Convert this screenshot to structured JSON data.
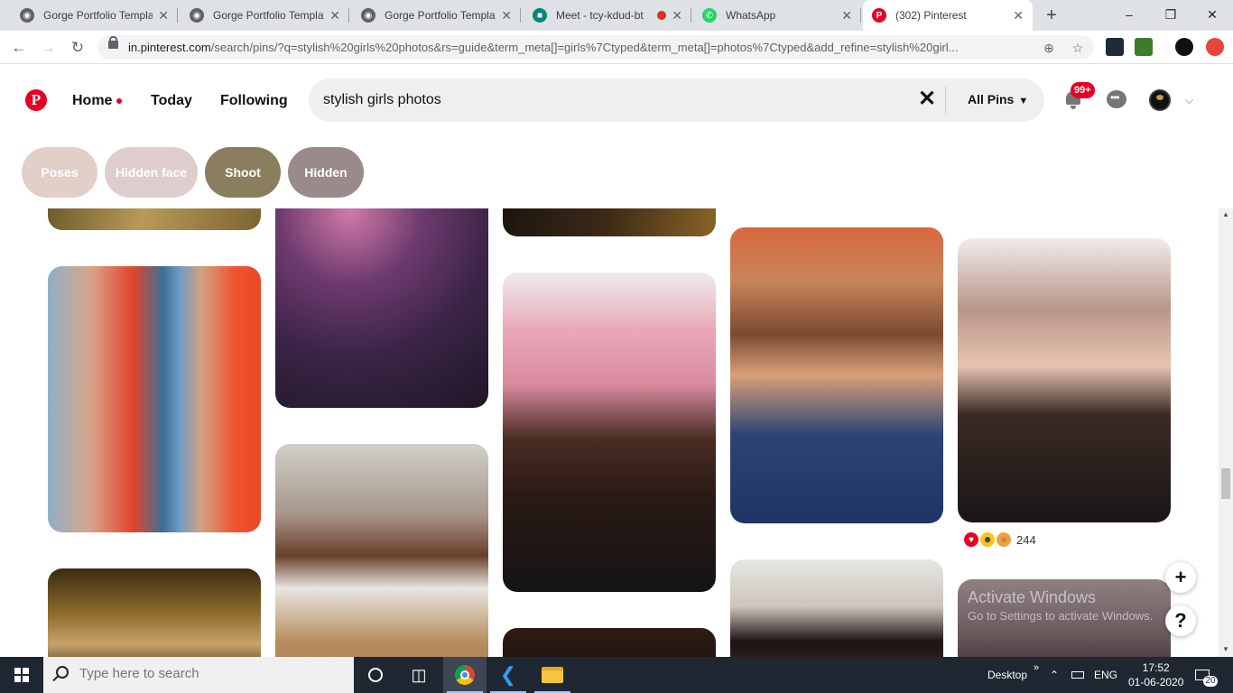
{
  "browser": {
    "tabs": [
      {
        "title": "Gorge Portfolio Templat",
        "icon": "globe-icon"
      },
      {
        "title": "Gorge Portfolio Templat",
        "icon": "globe-icon"
      },
      {
        "title": "Gorge Portfolio Templat",
        "icon": "globe-icon"
      },
      {
        "title": "Meet - tcy-kdud-bt",
        "icon": "meet-icon"
      },
      {
        "title": "WhatsApp",
        "icon": "whatsapp-icon"
      },
      {
        "title": "(302) Pinterest",
        "icon": "pinterest-icon"
      }
    ],
    "new_tab": "+",
    "window_controls": [
      "–",
      "❐",
      "✕"
    ],
    "url_host": "in.pinterest.com",
    "url_path": "/search/pins/?q=stylish%20girls%20photos&rs=guide&term_meta[]=girls%7Ctyped&term_meta[]=photos%7Ctyped&add_refine=stylish%20girl..."
  },
  "header": {
    "logo": "P",
    "nav": [
      "Home",
      "Today",
      "Following"
    ],
    "search_value": "stylish girls photos",
    "scope_label": "All Pins",
    "notification_badge": "99+"
  },
  "pills": [
    {
      "label": "Poses",
      "color": "#e1cfc8"
    },
    {
      "label": "Hidden face",
      "color": "#dfcccc"
    },
    {
      "label": "Shoot",
      "color": "#8a7e5f"
    },
    {
      "label": "Hidden",
      "color": "#9a8a8a"
    }
  ],
  "reactions": {
    "count": "244"
  },
  "fabs": {
    "add": "+",
    "help": "?"
  },
  "watermark": {
    "title": "Activate Windows",
    "subtitle": "Go to Settings to activate Windows."
  },
  "taskbar": {
    "search_placeholder": "Type here to search",
    "desktop_label": "Desktop",
    "language": "ENG",
    "time": "17:52",
    "date": "01-06-2020",
    "notifications": "20"
  }
}
